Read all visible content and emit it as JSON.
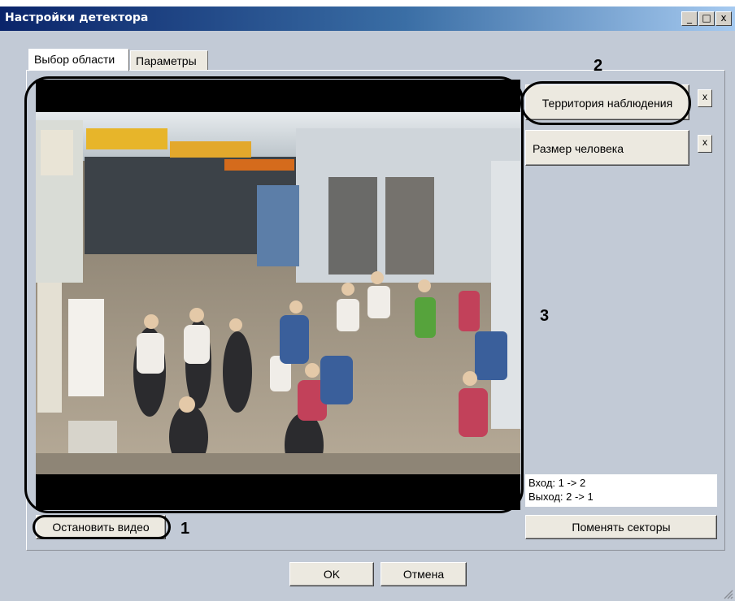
{
  "window": {
    "title": "Настройки детектора",
    "controls": {
      "minimize": "_",
      "maximize": "□",
      "close": "x"
    }
  },
  "tabs": [
    {
      "label": "Выбор области",
      "active": true
    },
    {
      "label": "Параметры",
      "active": false
    }
  ],
  "zones": [
    {
      "label": "Территория наблюдения",
      "remove": "x"
    },
    {
      "label": "Размер человека",
      "remove": "x"
    }
  ],
  "sector_info": {
    "line1": "Вход: 1 -> 2",
    "line2": "Выход: 2 -> 1"
  },
  "buttons": {
    "stop_video": "Остановить видео",
    "swap_sectors": "Поменять секторы",
    "ok": "OK",
    "cancel": "Отмена"
  },
  "annotations": {
    "one": "1",
    "two": "2",
    "three": "3"
  },
  "colors": {
    "dialog_bg": "#c2cad6",
    "button_face": "#ece9e0",
    "title_start": "#0a246a",
    "title_end": "#a6caf0"
  }
}
